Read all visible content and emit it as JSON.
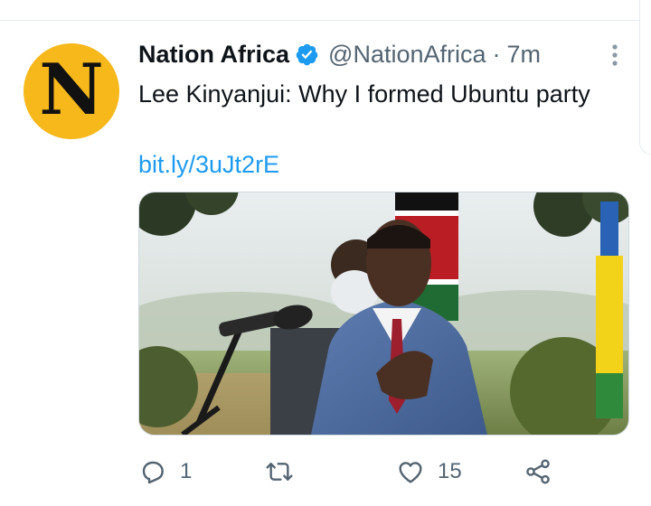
{
  "tweet": {
    "avatar_letter": "N",
    "display_name": "Nation Africa",
    "handle": "@NationAfrica",
    "separator": "·",
    "time": "7m",
    "text": "Lee Kinyanjui: Why I formed Ubuntu party",
    "link": "bit.ly/3uJt2rE",
    "media_icon": "photo"
  },
  "actions": {
    "reply": {
      "icon": "reply-icon",
      "count": "1"
    },
    "retweet": {
      "icon": "retweet-icon",
      "count": ""
    },
    "like": {
      "icon": "heart-icon",
      "count": "15"
    },
    "share": {
      "icon": "share-icon"
    }
  },
  "colors": {
    "link": "#1d9bf0",
    "verified": "#1d9bf0",
    "muted": "#536471",
    "avatar_bg": "#f6b81a"
  }
}
